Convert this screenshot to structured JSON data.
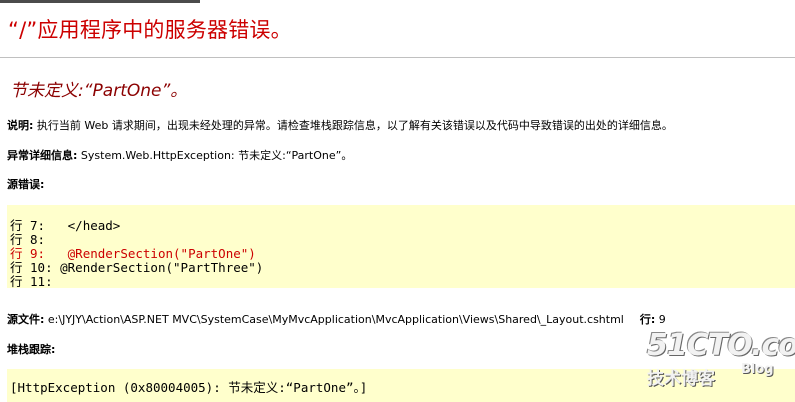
{
  "page": {
    "title": "“/”应用程序中的服务器错误。",
    "error_heading": "节未定义:“PartOne”。"
  },
  "details": {
    "description_label": "说明:",
    "description_text": " 执行当前 Web 请求期间，出现未经处理的异常。请检查堆栈跟踪信息，以了解有关该错误以及代码中导致错误的出处的详细信息。",
    "exception_label": "异常详细信息:",
    "exception_text": " System.Web.HttpException: 节未定义:“PartOne”。",
    "source_error_label": "源错误:"
  },
  "source_code": [
    {
      "text": "行 7:   </head>",
      "highlight": false
    },
    {
      "text": "行 8:",
      "highlight": false
    },
    {
      "text": "行 9:   @RenderSection(\"PartOne\")",
      "highlight": true
    },
    {
      "text": "行 10: @RenderSection(\"PartThree\")",
      "highlight": false
    },
    {
      "text": "行 11:",
      "highlight": false
    }
  ],
  "source_file": {
    "label": "源文件:",
    "path": " e:\\JYJY\\Action\\ASP.NET MVC\\SystemCase\\MyMvcApplication\\MvcApplication\\Views\\Shared\\_Layout.cshtml",
    "line_label": "行:",
    "line_number": " 9"
  },
  "stack_trace": {
    "label": "堆栈跟踪:",
    "first_line": "[HttpException (0x80004005): 节未定义:“PartOne”。]"
  },
  "watermark": {
    "brand": "51CTO.com",
    "subtitle": "技术博客",
    "blog": "Blog"
  }
}
